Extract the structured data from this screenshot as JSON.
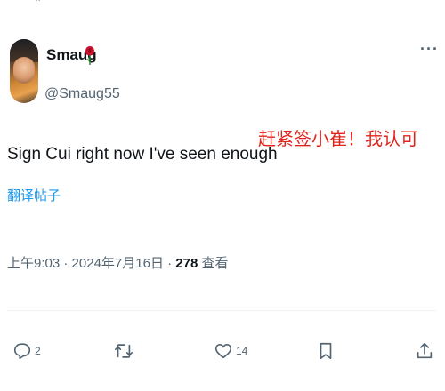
{
  "tweet": {
    "display_name": "Smaug",
    "name_emoji_icon": "rose-icon",
    "handle": "@Smaug55",
    "text": "Sign Cui right now I've seen enough",
    "translate_label": "翻译帖子",
    "time": "上午9:03",
    "date": "2024年7月16日",
    "sep": "·",
    "views_count": "278",
    "views_label": "查看"
  },
  "annotation": "赶紧签小崔！我认可",
  "actions": {
    "reply_count": "2",
    "like_count": "14"
  },
  "colors": {
    "link": "#1d9bf0",
    "annotation": "#e0241b",
    "muted": "#536471"
  }
}
